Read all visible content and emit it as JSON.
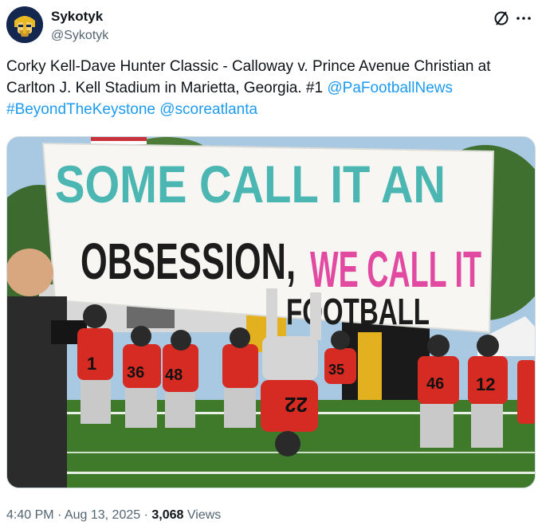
{
  "author": {
    "display_name": "Sykotyk",
    "handle": "@Sykotyk",
    "avatar_icon": "viking-helmet-avatar"
  },
  "actions": {
    "grok_icon": "grok-slash-icon",
    "more_icon": "more-dots-icon"
  },
  "tweet": {
    "text_main": "Corky Kell-Dave Hunter Classic - Calloway v. Prince Avenue Christian at Carlton J. Kell Stadium in Marietta, Georgia. #1 ",
    "mention_1": "@PaFootballNews",
    "hashtag_1": "#BeyondTheKeystone",
    "mention_2": "@scoreatlanta"
  },
  "media": {
    "banner_line_1": "SOME CALL IT AN",
    "banner_line_2a": "OBSESSION,",
    "banner_line_2b": "WE CALL IT",
    "banner_line_3": "FOOTBALL",
    "player_numbers": [
      "1",
      "36",
      "48",
      "35",
      "46",
      "12",
      "22"
    ]
  },
  "meta": {
    "time": "4:40 PM",
    "separator": "·",
    "date": "Aug 13, 2025",
    "views_count": "3,068",
    "views_label": "Views"
  },
  "colors": {
    "link": "#1d9bf0",
    "secondary_text": "#536471",
    "jersey_red": "#d62b22",
    "turf": "#3f7a2a"
  }
}
